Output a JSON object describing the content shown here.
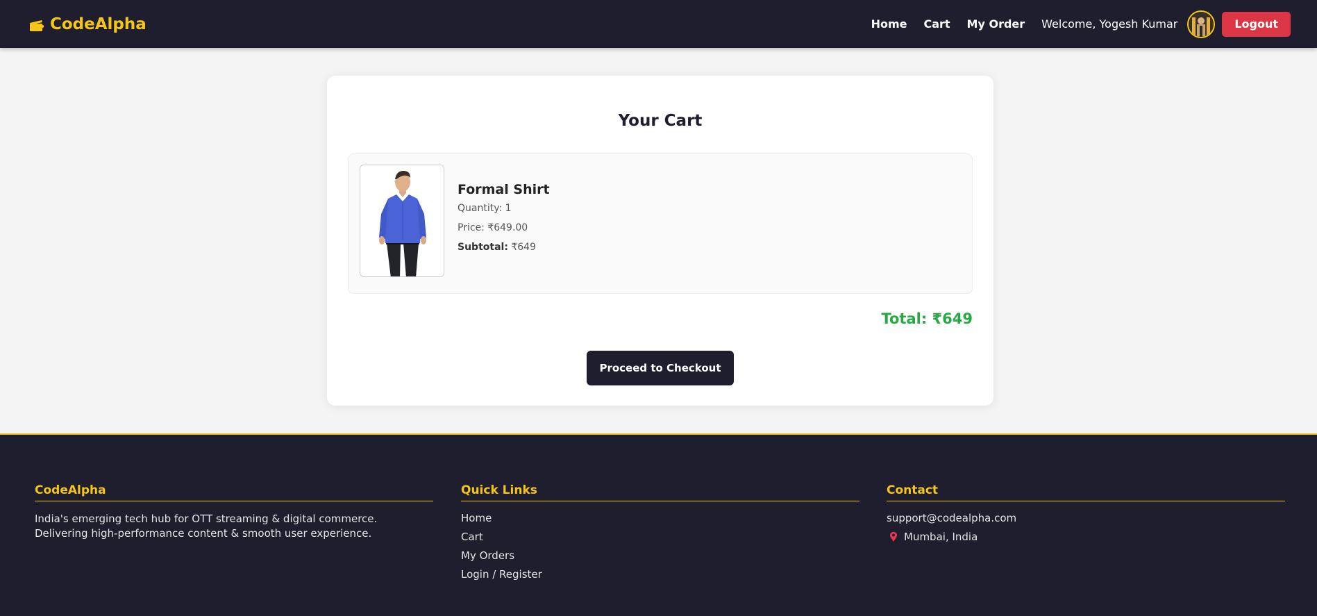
{
  "header": {
    "brand": "CodeAlpha",
    "nav": [
      "Home",
      "Cart",
      "My Order"
    ],
    "welcome": "Welcome, Yogesh Kumar",
    "logout": "Logout"
  },
  "cart": {
    "title": "Your Cart",
    "items": [
      {
        "name": "Formal Shirt",
        "quantity": "Quantity: 1",
        "price": "Price: ₹649.00",
        "subtotal_label": "Subtotal:",
        "subtotal_value": " ₹649"
      }
    ],
    "total": "Total: ₹649",
    "checkout": "Proceed to Checkout"
  },
  "footer": {
    "about": {
      "heading": "CodeAlpha",
      "text": "India's emerging tech hub for OTT streaming & digital commerce. Delivering high-performance content & smooth user experience."
    },
    "links": {
      "heading": "Quick Links",
      "items": [
        "Home",
        "Cart",
        "My Orders",
        "Login / Register"
      ]
    },
    "contact": {
      "heading": "Contact",
      "email": "support@codealpha.com",
      "location": "Mumbai, India"
    }
  },
  "colors": {
    "navbar_bg": "#1e1e2f",
    "brand_accent": "#f5c518",
    "logout": "#dc3545",
    "total": "#28a745"
  },
  "icons": {
    "brand": "clapperboard-icon",
    "location": "map-pin-icon"
  }
}
